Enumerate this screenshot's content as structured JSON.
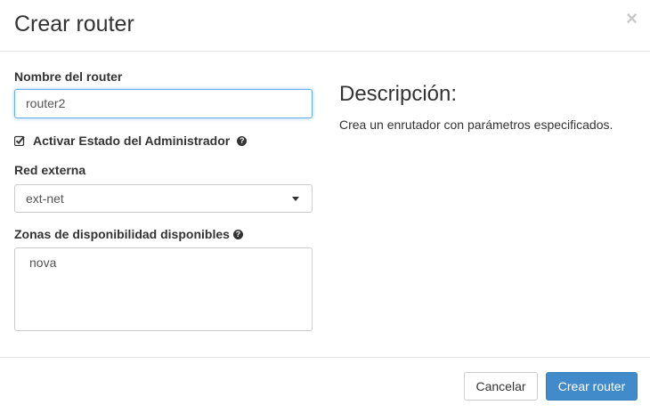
{
  "dialog": {
    "title": "Crear router",
    "close_symbol": "×"
  },
  "form": {
    "name_label": "Nombre del router",
    "name_value": "router2",
    "admin_state_label": "Activar Estado del Administrador",
    "admin_state_checked": true,
    "external_network_label": "Red externa",
    "external_network_value": "ext-net",
    "availability_zones_label": "Zonas de disponibilidad disponibles",
    "availability_zones_options": [
      "nova"
    ]
  },
  "help": {
    "title": "Descripción:",
    "text": "Crea un enrutador con parámetros especificados."
  },
  "footer": {
    "cancel_label": "Cancelar",
    "submit_label": "Crear router"
  },
  "colors": {
    "primary": "#428bca",
    "focus_border": "#66afe9"
  }
}
